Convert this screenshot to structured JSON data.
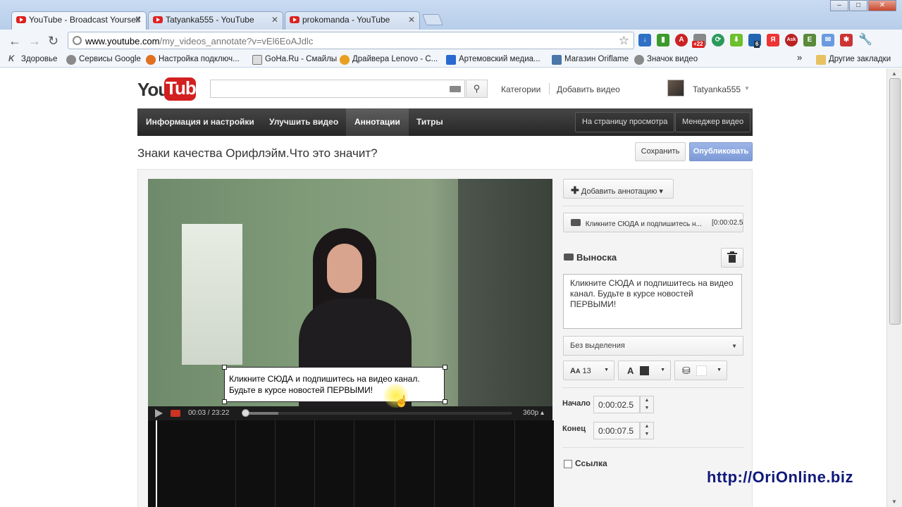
{
  "browser": {
    "tabs": [
      {
        "title": "YouTube - Broadcast Yourself"
      },
      {
        "title": "Tatyanka555 - YouTube"
      },
      {
        "title": "prokomanda - YouTube"
      }
    ],
    "url_domain": "www.youtube.com",
    "url_path": "/my_videos_annotate?v=vEl6EoAJdlc",
    "extension_badges": [
      "+22",
      "6"
    ],
    "bookmarks": [
      "Здоровье",
      "Сервисы Google",
      "Настройка подключ...",
      "GoHa.Ru - Смайлы",
      "Драйвера Lenovo - С...",
      "Артемовский медиа...",
      "Магазин Oriflame",
      "Значок видео"
    ],
    "more_bookmarks": "»",
    "other_bookmarks": "Другие закладки"
  },
  "youtube": {
    "logo_you": "You",
    "logo_tube": "Tube",
    "search_value": "",
    "header_links": [
      "Категории",
      "Добавить видео"
    ],
    "username": "Tatyanka555"
  },
  "editor": {
    "nav_tabs": [
      "Информация и настройки",
      "Улучшить видео",
      "Аннотации",
      "Титры"
    ],
    "active_tab": "Аннотации",
    "nav_buttons": [
      "На страницу просмотра",
      "Менеджер видео"
    ],
    "video_title": "Знаки качества Орифлэйм.Что это значит?",
    "save_label": "Сохранить",
    "publish_label": "Опубликовать"
  },
  "player": {
    "annotation_overlay": "Кликните СЮДА и подпишитесь на видео канал. Будьте в курсе новостей ПЕРВЫМИ!",
    "time": "00:03 / 23:22",
    "quality": "360p",
    "progress_fraction": 0.13
  },
  "annotation_panel": {
    "add_button": "Добавить аннотацию",
    "list_item_text": "Кликните СЮДА и подпишитесь н...",
    "list_item_time": "[0:00:02.5",
    "type_label": "Выноска",
    "text": "Кликните СЮДА и подпишитесь на видео канал. Будьте в курсе новостей ПЕРВЫМИ!",
    "highlight_select": "Без выделения",
    "font_size": "13",
    "start_label": "Начало",
    "start_value": "0:00:02.5",
    "end_label": "Конец",
    "end_value": "0:00:07.5",
    "link_label": "Ссылка"
  },
  "watermark": "http://OriOnline.biz",
  "colors": {
    "youtube_red": "#d31f1f",
    "navbar_dark": "#262626",
    "publish_blue": "#7d9ad7",
    "watermark": "#10187a"
  }
}
